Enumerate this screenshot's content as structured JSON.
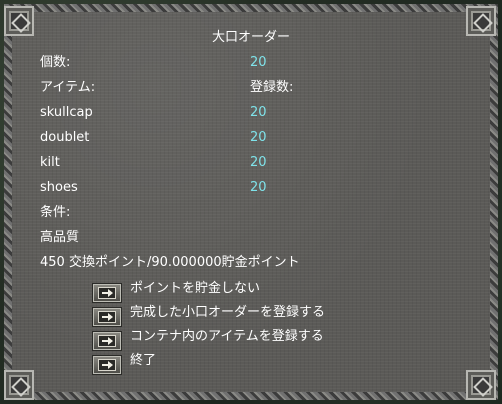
{
  "gump": {
    "title": "大口オーダー",
    "count_label": "個数:",
    "count_value": "20",
    "item_header": "アイテム:",
    "registered_header": "登録数:",
    "items": [
      {
        "name": "skullcap",
        "registered": "20"
      },
      {
        "name": "doublet",
        "registered": "20"
      },
      {
        "name": "kilt",
        "registered": "20"
      },
      {
        "name": "shoes",
        "registered": "20"
      }
    ],
    "condition_label": "条件:",
    "quality": "高品質",
    "points_line": "450 交換ポイント/90.000000貯金ポイント",
    "options": [
      {
        "label": "ポイントを貯金しない",
        "icon": "arrow-right-icon"
      },
      {
        "label": "完成した小口オーダーを登録する",
        "icon": "arrow-right-icon"
      },
      {
        "label": "コンテナ内のアイテムを登録する",
        "icon": "arrow-right-icon"
      },
      {
        "label": "終了",
        "icon": "arrow-right-icon"
      }
    ]
  },
  "colors": {
    "panel_bg": "#5b5a57",
    "text": "#ffffff",
    "value_text": "#7fe3ea"
  }
}
